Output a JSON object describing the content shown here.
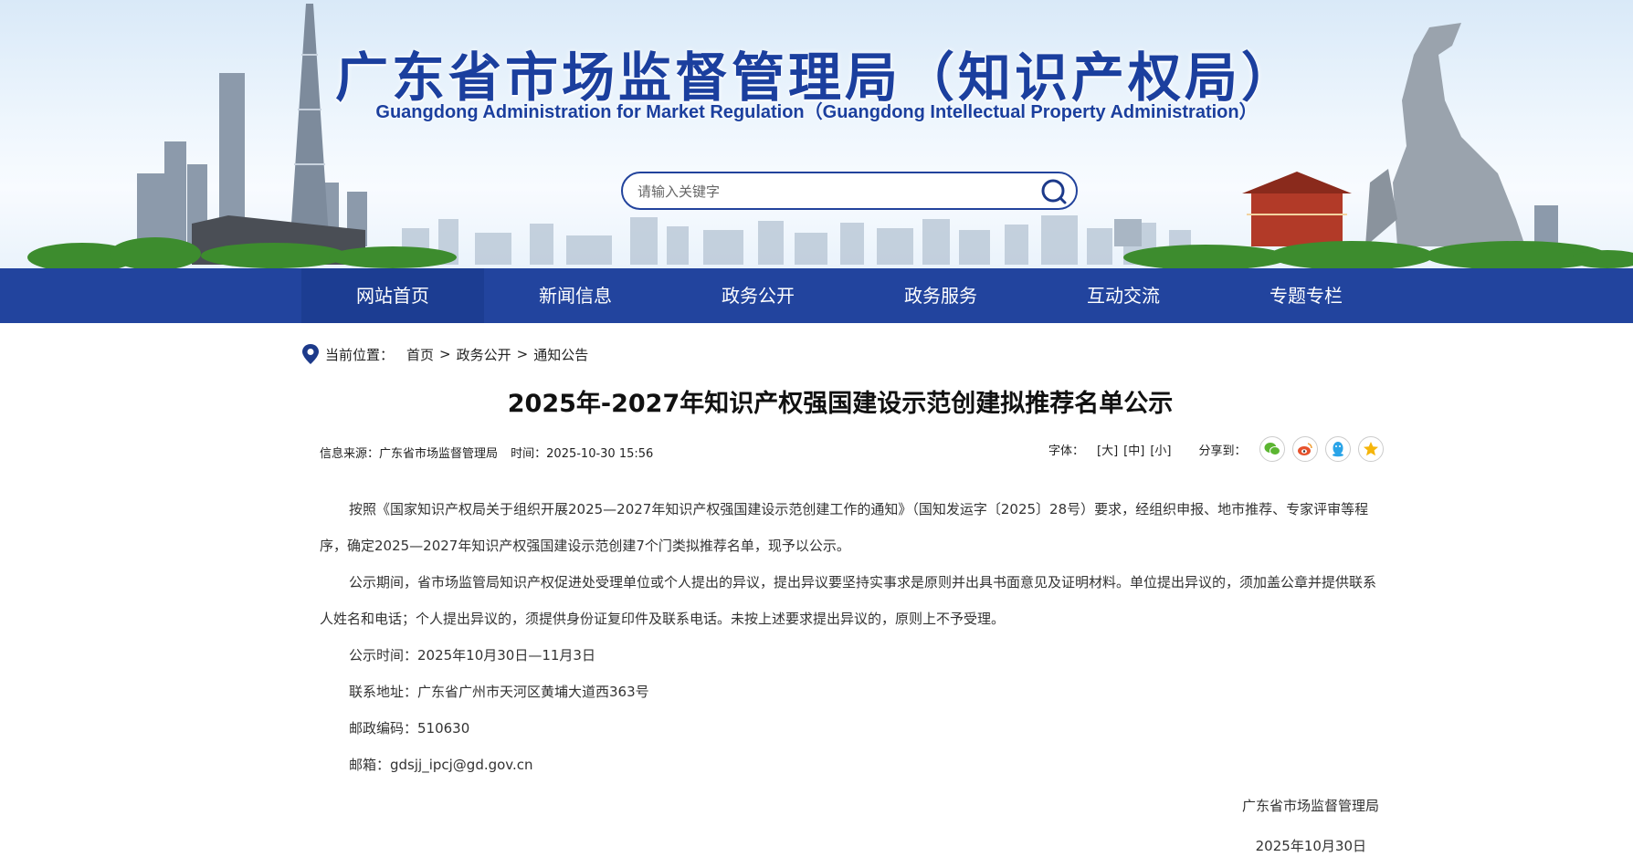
{
  "header": {
    "title": "广东省市场监督管理局（知识产权局）",
    "subtitle": "Guangdong Administration for Market Regulation（Guangdong Intellectual Property Administration）",
    "search_placeholder": "请输入关键字",
    "search_icon": "search-icon"
  },
  "nav": {
    "items": [
      {
        "label": "网站首页",
        "active": true
      },
      {
        "label": "新闻信息"
      },
      {
        "label": "政务公开"
      },
      {
        "label": "政务服务"
      },
      {
        "label": "互动交流"
      },
      {
        "label": "专题专栏"
      }
    ]
  },
  "breadcrumb": {
    "icon": "location-pin-icon",
    "label": "当前位置：",
    "items": [
      "首页",
      "政务公开",
      "通知公告"
    ],
    "separator": ">"
  },
  "article": {
    "title": "2025年-2027年知识产权强国建设示范创建拟推荐名单公示",
    "source": "信息来源：广东省市场监督管理局",
    "time": "时间：2025-10-30 15:56",
    "font_size_label": "字体：",
    "font_sizes": [
      "[大]",
      "[中]",
      "[小]"
    ],
    "share_label": "分享到：",
    "share_icons": [
      "wechat-icon",
      "weibo-icon",
      "qq-icon",
      "qzone-icon"
    ],
    "paragraphs": [
      "按照《国家知识产权局关于组织开展2025—2027年知识产权强国建设示范创建工作的通知》（国知发运字〔2025〕28号）要求，经组织申报、地市推荐、专家评审等程序，确定2025—2027年知识产权强国建设示范创建7个门类拟推荐名单，现予以公示。",
      "公示期间，省市场监管局知识产权促进处受理单位或个人提出的异议，提出异议要坚持实事求是原则并出具书面意见及证明材料。单位提出异议的，须加盖公章并提供联系人姓名和电话；个人提出异议的，须提供身份证复印件及联系电话。未按上述要求提出异议的，原则上不予受理。",
      "公示时间：2025年10月30日—11月3日",
      "联系地址：广东省广州市天河区黄埔大道西363号",
      "邮政编码：510630",
      "邮箱：gdsjj_ipcj@gd.gov.cn"
    ],
    "signature_org": "广东省市场监督管理局",
    "signature_date": "2025年10月30日"
  },
  "colors": {
    "brand_blue": "#22449e",
    "title_blue": "#1b3f9e"
  }
}
